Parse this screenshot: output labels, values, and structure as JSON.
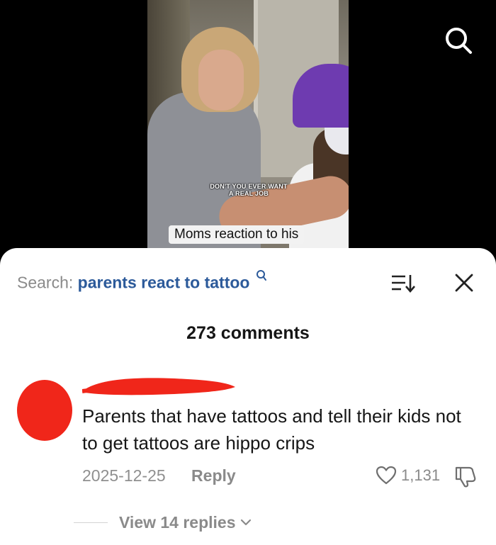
{
  "video": {
    "overlay_caption": "DON'T YOU EVER WANT A REAL JOB",
    "caption": "Moms reaction to his"
  },
  "icons": {
    "top_search": "search-icon",
    "sort": "sort-icon",
    "close": "close-icon",
    "like": "heart-icon",
    "dislike": "dislike-icon",
    "chevron": "chevron-down-icon"
  },
  "search": {
    "prefix": "Search:",
    "term": "parents react to tattoo"
  },
  "comments": {
    "count_label": "273 comments",
    "items": [
      {
        "text": "Parents that have tattoos and tell their kids not to get tattoos are hippo crips",
        "date": "2025-12-25",
        "reply_label": "Reply",
        "likes": "1,131",
        "view_replies_label": "View 14 replies"
      }
    ]
  },
  "colors": {
    "search_term": "#2c5a9a",
    "redaction": "#f0261a",
    "muted_text": "#8a8a8a"
  }
}
